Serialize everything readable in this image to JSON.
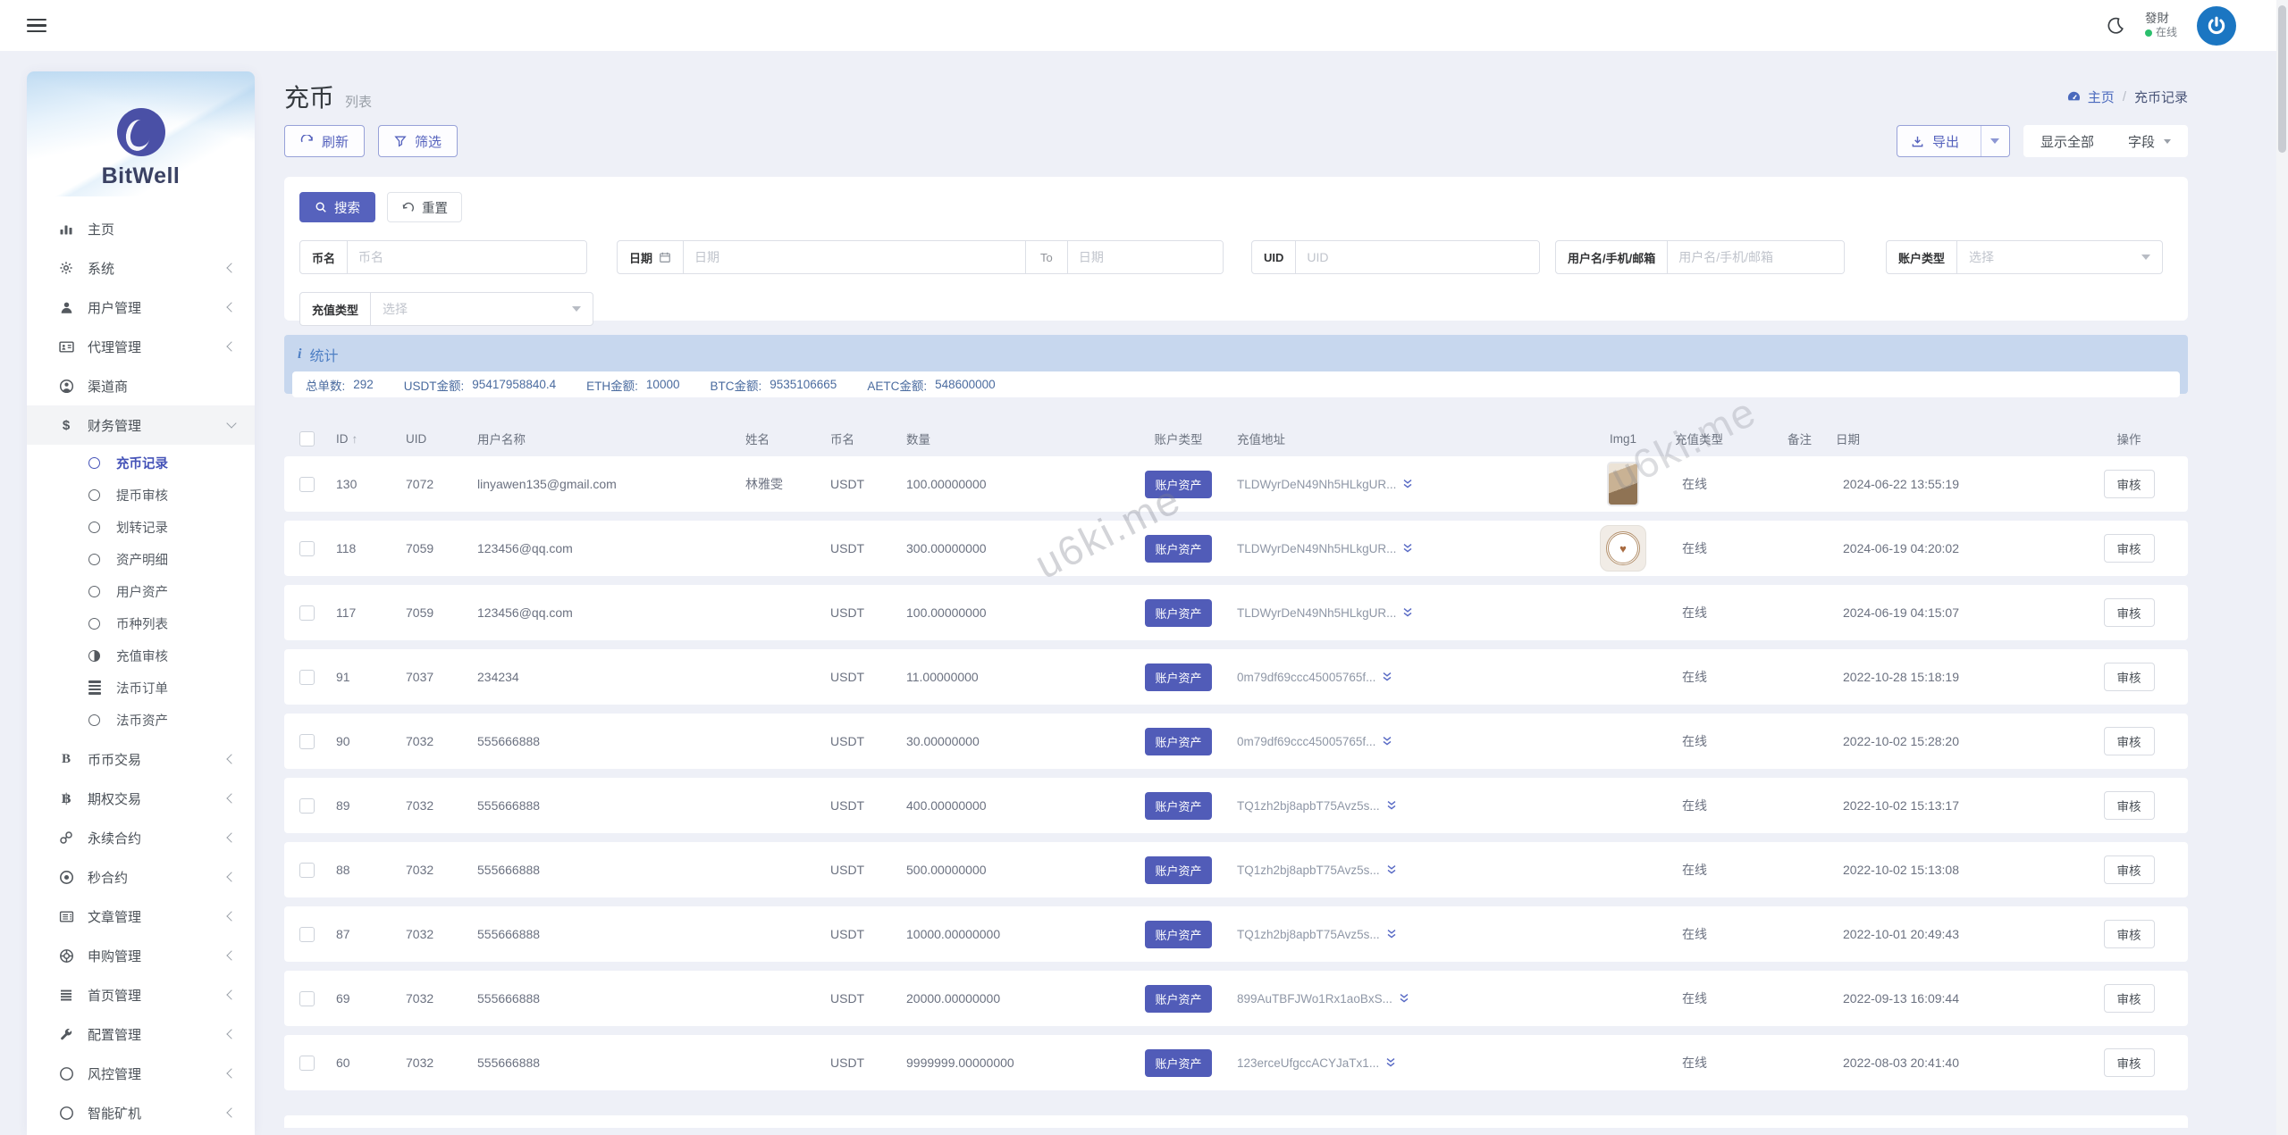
{
  "header": {
    "user_name": "發財",
    "user_status": "在线"
  },
  "sidebar": {
    "brand": "BitWell",
    "items": [
      {
        "label": "主页"
      },
      {
        "label": "系统"
      },
      {
        "label": "用户管理"
      },
      {
        "label": "代理管理"
      },
      {
        "label": "渠道商"
      },
      {
        "label": "财务管理"
      },
      {
        "label": "币币交易"
      },
      {
        "label": "期权交易"
      },
      {
        "label": "永续合约"
      },
      {
        "label": "秒合约"
      },
      {
        "label": "文章管理"
      },
      {
        "label": "申购管理"
      },
      {
        "label": "首页管理"
      },
      {
        "label": "配置管理"
      },
      {
        "label": "风控管理"
      },
      {
        "label": "智能矿机"
      }
    ],
    "finance_children": [
      {
        "label": "充币记录"
      },
      {
        "label": "提币审核"
      },
      {
        "label": "划转记录"
      },
      {
        "label": "资产明细"
      },
      {
        "label": "用户资产"
      },
      {
        "label": "币种列表"
      },
      {
        "label": "充值审核"
      },
      {
        "label": "法币订单"
      },
      {
        "label": "法币资产"
      }
    ]
  },
  "page": {
    "title": "充币",
    "subtitle": "列表",
    "breadcrumb_home": "主页",
    "breadcrumb_sep": "/",
    "breadcrumb_current": "充币记录"
  },
  "toolbar": {
    "refresh": "刷新",
    "filter": "筛选",
    "export": "导出",
    "show_all": "显示全部",
    "fields": "字段"
  },
  "search": {
    "submit": "搜索",
    "reset": "重置",
    "coin_label": "币名",
    "coin_placeholder": "币名",
    "date_label": "日期",
    "date_from_placeholder": "日期",
    "date_to_label": "To",
    "date_to_placeholder": "日期",
    "uid_label": "UID",
    "uid_placeholder": "UID",
    "user_label": "用户名/手机/邮箱",
    "user_placeholder": "用户名/手机/邮箱",
    "account_type_label": "账户类型",
    "account_type_value": "选择",
    "recharge_type_label": "充值类型",
    "recharge_type_value": "选择"
  },
  "stats": {
    "title": "统计",
    "items": [
      {
        "label": "总单数:",
        "value": "292"
      },
      {
        "label": "USDT金额:",
        "value": "95417958840.4"
      },
      {
        "label": "ETH金额:",
        "value": "10000"
      },
      {
        "label": "BTC金额:",
        "value": "9535106665"
      },
      {
        "label": "AETC金额:",
        "value": "548600000"
      }
    ]
  },
  "table": {
    "columns": [
      "ID",
      "UID",
      "用户名称",
      "姓名",
      "币名",
      "数量",
      "账户类型",
      "充值地址",
      "Img1",
      "充值类型",
      "备注",
      "日期",
      "操作"
    ],
    "rows": [
      {
        "id": "130",
        "uid": "7072",
        "username": "linyawen135@gmail.com",
        "realname": "林雅雯",
        "coin": "USDT",
        "amount": "100.00000000",
        "account_type": "账户资产",
        "address": "TLDWyrDeN49Nh5HLkgUR...",
        "img_photo": true,
        "recharge_type": "在线",
        "remark": "",
        "date": "2024-06-22 13:55:19",
        "action": "审核"
      },
      {
        "id": "118",
        "uid": "7059",
        "username": "123456@qq.com",
        "realname": "",
        "coin": "USDT",
        "amount": "300.00000000",
        "account_type": "账户资产",
        "address": "TLDWyrDeN49Nh5HLkgUR...",
        "img_logo": true,
        "recharge_type": "在线",
        "remark": "",
        "date": "2024-06-19 04:20:02",
        "action": "审核"
      },
      {
        "id": "117",
        "uid": "7059",
        "username": "123456@qq.com",
        "realname": "",
        "coin": "USDT",
        "amount": "100.00000000",
        "account_type": "账户资产",
        "address": "TLDWyrDeN49Nh5HLkgUR...",
        "recharge_type": "在线",
        "remark": "",
        "date": "2024-06-19 04:15:07",
        "action": "审核"
      },
      {
        "id": "91",
        "uid": "7037",
        "username": "234234",
        "realname": "",
        "coin": "USDT",
        "amount": "11.00000000",
        "account_type": "账户资产",
        "address": "0m79df69ccc45005765f...",
        "recharge_type": "在线",
        "remark": "",
        "date": "2022-10-28 15:18:19",
        "action": "审核"
      },
      {
        "id": "90",
        "uid": "7032",
        "username": "555666888",
        "realname": "",
        "coin": "USDT",
        "amount": "30.00000000",
        "account_type": "账户资产",
        "address": "0m79df69ccc45005765f...",
        "recharge_type": "在线",
        "remark": "",
        "date": "2022-10-02 15:28:20",
        "action": "审核"
      },
      {
        "id": "89",
        "uid": "7032",
        "username": "555666888",
        "realname": "",
        "coin": "USDT",
        "amount": "400.00000000",
        "account_type": "账户资产",
        "address": "TQ1zh2bj8apbT75Avz5s...",
        "recharge_type": "在线",
        "remark": "",
        "date": "2022-10-02 15:13:17",
        "action": "审核"
      },
      {
        "id": "88",
        "uid": "7032",
        "username": "555666888",
        "realname": "",
        "coin": "USDT",
        "amount": "500.00000000",
        "account_type": "账户资产",
        "address": "TQ1zh2bj8apbT75Avz5s...",
        "recharge_type": "在线",
        "remark": "",
        "date": "2022-10-02 15:13:08",
        "action": "审核"
      },
      {
        "id": "87",
        "uid": "7032",
        "username": "555666888",
        "realname": "",
        "coin": "USDT",
        "amount": "10000.00000000",
        "account_type": "账户资产",
        "address": "TQ1zh2bj8apbT75Avz5s...",
        "recharge_type": "在线",
        "remark": "",
        "date": "2022-10-01 20:49:43",
        "action": "审核"
      },
      {
        "id": "69",
        "uid": "7032",
        "username": "555666888",
        "realname": "",
        "coin": "USDT",
        "amount": "20000.00000000",
        "account_type": "账户资产",
        "address": "899AuTBFJWo1Rx1aoBxS...",
        "recharge_type": "在线",
        "remark": "",
        "date": "2022-09-13 16:09:44",
        "action": "审核"
      },
      {
        "id": "60",
        "uid": "7032",
        "username": "555666888",
        "realname": "",
        "coin": "USDT",
        "amount": "9999999.00000000",
        "account_type": "账户资产",
        "address": "123erceUfgccACYJaTx1...",
        "recharge_type": "在线",
        "remark": "",
        "date": "2022-08-03 20:41:40",
        "action": "审核"
      }
    ]
  },
  "watermark": "u6ki.me",
  "colors": {
    "primary": "#5662bd",
    "stats_bg": "#c7d7ee",
    "online_green": "#2bbf6d",
    "avatar_blue": "#1b76c2"
  }
}
